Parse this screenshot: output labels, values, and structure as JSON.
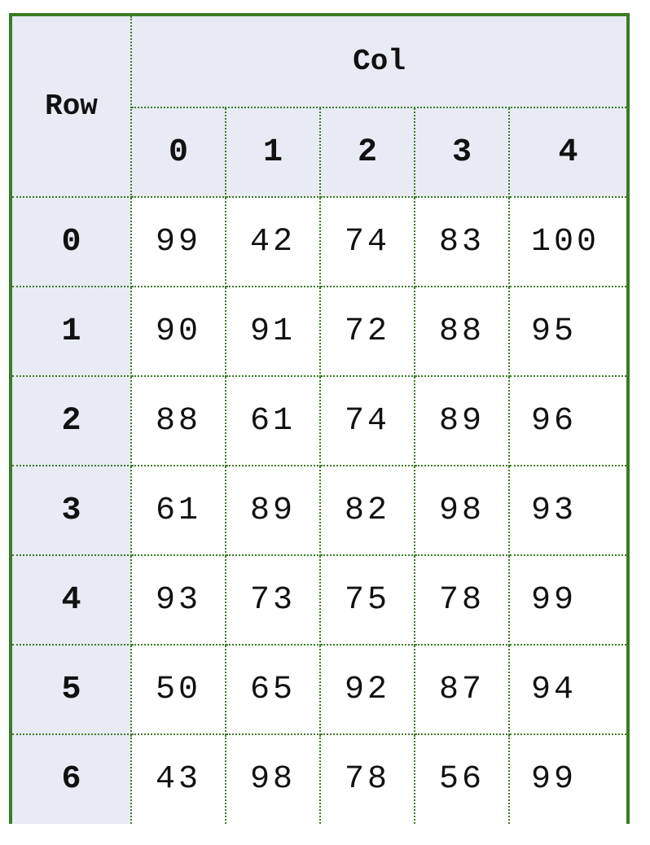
{
  "chart_data": {
    "type": "table",
    "row_header": "Row",
    "col_header": "Col",
    "columns": [
      "0",
      "1",
      "2",
      "3",
      "4"
    ],
    "rows": [
      {
        "label": "0",
        "values": [
          "99",
          "42",
          "74",
          "83",
          "100"
        ]
      },
      {
        "label": "1",
        "values": [
          "90",
          "91",
          "72",
          "88",
          "95"
        ]
      },
      {
        "label": "2",
        "values": [
          "88",
          "61",
          "74",
          "89",
          "96"
        ]
      },
      {
        "label": "3",
        "values": [
          "61",
          "89",
          "82",
          "98",
          "93"
        ]
      },
      {
        "label": "4",
        "values": [
          "93",
          "73",
          "75",
          "78",
          "99"
        ]
      },
      {
        "label": "5",
        "values": [
          "50",
          "65",
          "92",
          "87",
          "94"
        ]
      },
      {
        "label": "6",
        "values": [
          "43",
          "98",
          "78",
          "56",
          "99"
        ]
      }
    ]
  },
  "colors": {
    "border": "#3a7d23",
    "header_bg": "#e8eaf4",
    "cell_bg": "#ffffff",
    "text": "#111111"
  }
}
